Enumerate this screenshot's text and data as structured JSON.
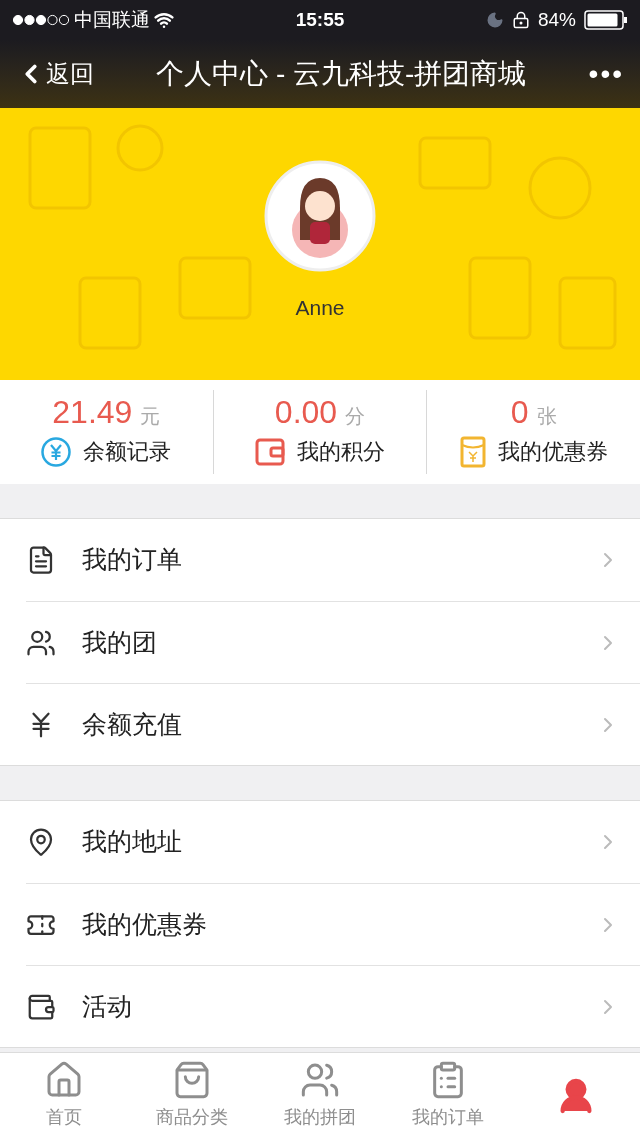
{
  "status_bar": {
    "carrier": "中国联通",
    "time": "15:55",
    "battery": "84%"
  },
  "nav": {
    "back": "返回",
    "title": "个人中心 - 云九科技-拼团商城",
    "more": "•••"
  },
  "profile": {
    "name": "Anne"
  },
  "stats": [
    {
      "kind": "balance",
      "value": "21.49",
      "unit": "元",
      "label": "余额记录"
    },
    {
      "kind": "points",
      "value": "0.00",
      "unit": "分",
      "label": "我的积分"
    },
    {
      "kind": "coupon",
      "value": "0",
      "unit": "张",
      "label": "我的优惠券"
    }
  ],
  "menu_groups": [
    [
      {
        "kind": "orders",
        "label": "我的订单"
      },
      {
        "kind": "group",
        "label": "我的团"
      },
      {
        "kind": "recharge",
        "label": "余额充值"
      }
    ],
    [
      {
        "kind": "address",
        "label": "我的地址"
      },
      {
        "kind": "coupon",
        "label": "我的优惠券"
      },
      {
        "kind": "activity",
        "label": "活动"
      }
    ]
  ],
  "tabs": [
    {
      "kind": "home",
      "label": "首页",
      "selected": false
    },
    {
      "kind": "category",
      "label": "商品分类",
      "selected": false
    },
    {
      "kind": "group",
      "label": "我的拼团",
      "selected": false
    },
    {
      "kind": "orders",
      "label": "我的订单",
      "selected": false
    },
    {
      "kind": "profile",
      "selected": true
    }
  ]
}
